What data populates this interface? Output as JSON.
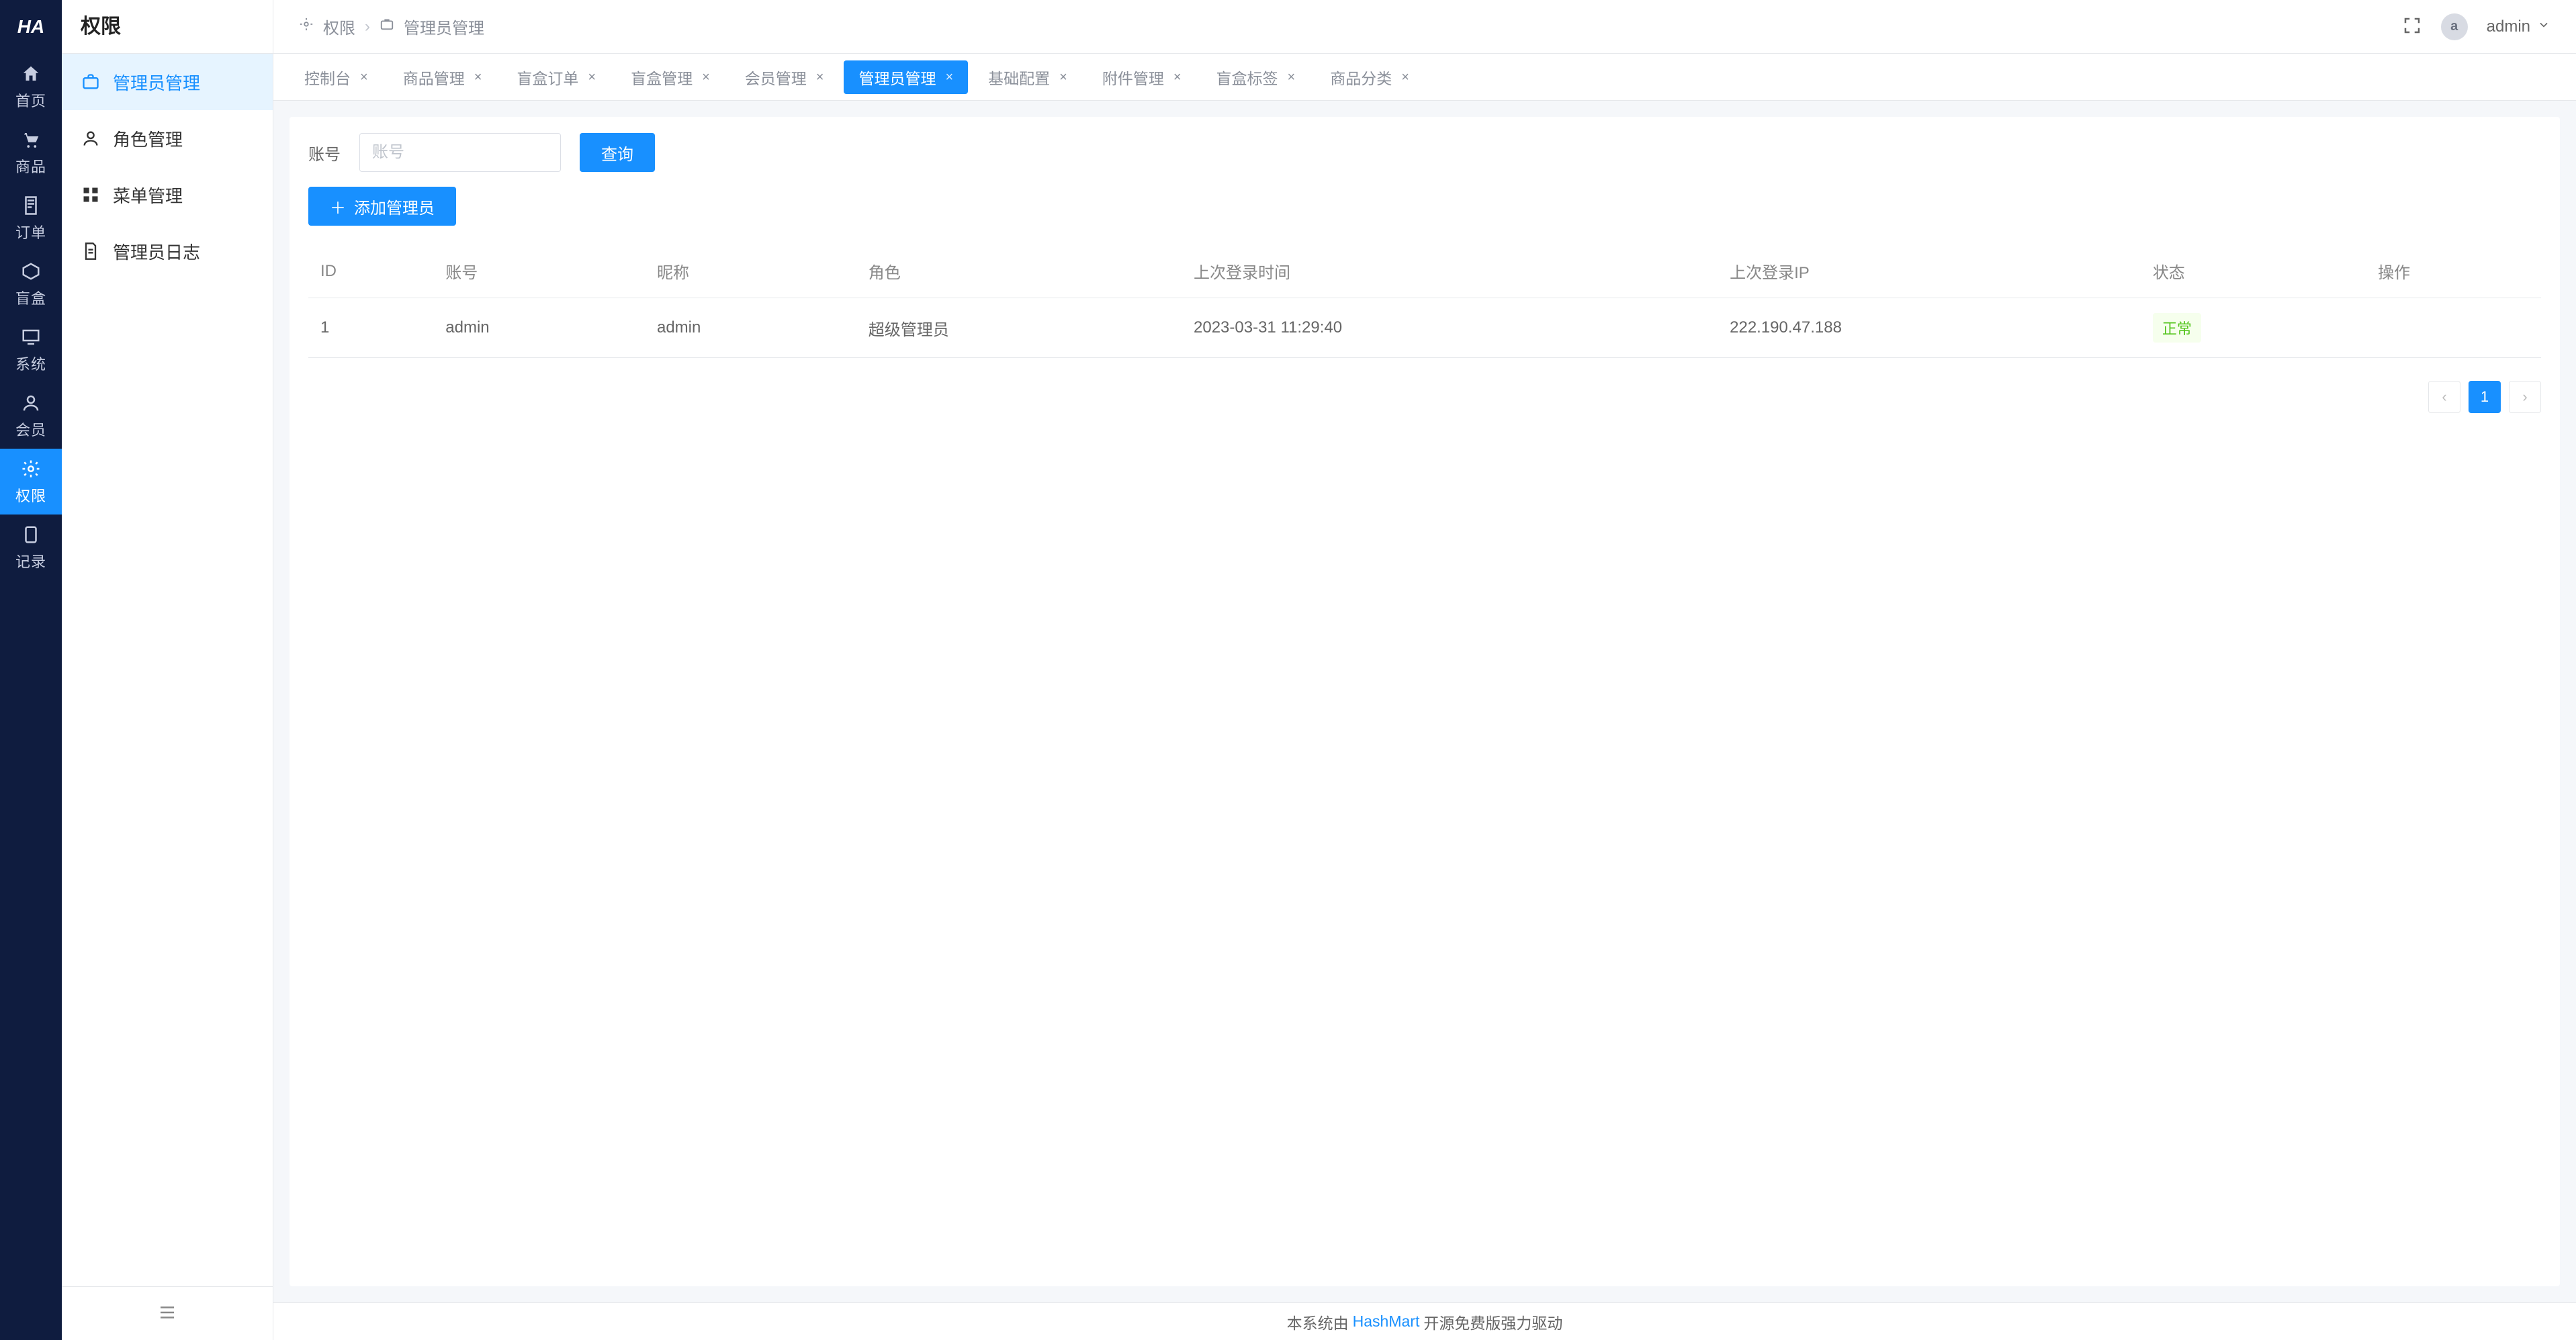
{
  "logo_text": "HA",
  "nav_primary": [
    {
      "key": "home",
      "label": "首页"
    },
    {
      "key": "goods",
      "label": "商品"
    },
    {
      "key": "order",
      "label": "订单"
    },
    {
      "key": "blindbox",
      "label": "盲盒"
    },
    {
      "key": "system",
      "label": "系统"
    },
    {
      "key": "member",
      "label": "会员"
    },
    {
      "key": "permission",
      "label": "权限"
    },
    {
      "key": "record",
      "label": "记录"
    }
  ],
  "nav_secondary_title": "权限",
  "nav_secondary": [
    {
      "key": "admin-mgmt",
      "label": "管理员管理",
      "active": true
    },
    {
      "key": "role-mgmt",
      "label": "角色管理"
    },
    {
      "key": "menu-mgmt",
      "label": "菜单管理"
    },
    {
      "key": "admin-log",
      "label": "管理员日志"
    }
  ],
  "breadcrumb": {
    "root": "权限",
    "leaf": "管理员管理"
  },
  "user": {
    "avatar_letter": "a",
    "name": "admin"
  },
  "tabs": [
    {
      "label": "控制台",
      "active": false
    },
    {
      "label": "商品管理",
      "active": false
    },
    {
      "label": "盲盒订单",
      "active": false
    },
    {
      "label": "盲盒管理",
      "active": false
    },
    {
      "label": "会员管理",
      "active": false
    },
    {
      "label": "管理员管理",
      "active": true
    },
    {
      "label": "基础配置",
      "active": false
    },
    {
      "label": "附件管理",
      "active": false
    },
    {
      "label": "盲盒标签",
      "active": false
    },
    {
      "label": "商品分类",
      "active": false
    }
  ],
  "filter": {
    "label": "账号",
    "placeholder": "账号",
    "search_btn": "查询",
    "add_btn": "添加管理员"
  },
  "table": {
    "columns": [
      "ID",
      "账号",
      "昵称",
      "角色",
      "上次登录时间",
      "上次登录IP",
      "状态",
      "操作"
    ],
    "rows": [
      {
        "id": "1",
        "account": "admin",
        "nickname": "admin",
        "role": "超级管理员",
        "last_login_time": "2023-03-31 11:29:40",
        "last_login_ip": "222.190.47.188",
        "status": "正常"
      }
    ]
  },
  "pagination": {
    "current": "1"
  },
  "footer": {
    "prefix": "本系统由",
    "link": "HashMart",
    "suffix": "开源免费版强力驱动"
  }
}
